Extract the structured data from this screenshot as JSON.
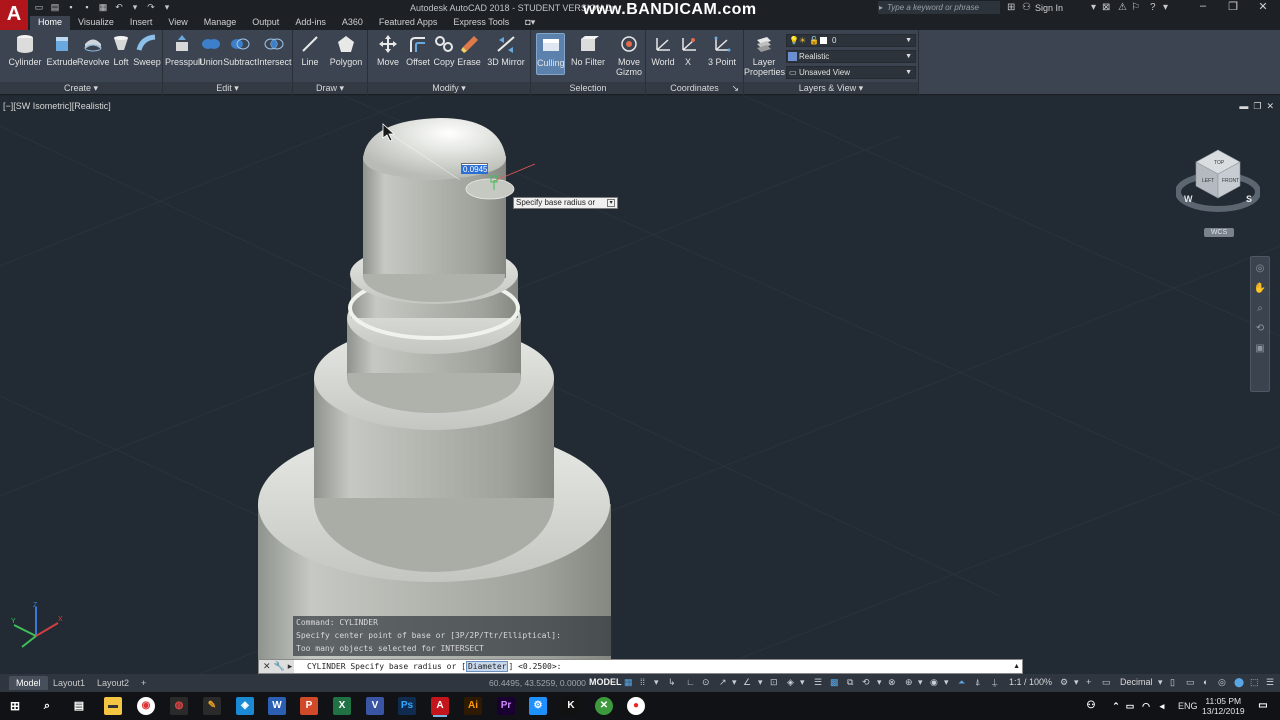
{
  "window": {
    "title": "Autodesk AutoCAD 2018 - STUDENT VERSION    Dr",
    "watermark": "www.BANDICAM.com",
    "search_placeholder": "Type a keyword or phrase",
    "sign_in": "Sign In"
  },
  "app_logo": "A",
  "ribbon_tabs": [
    "Home",
    "Visualize",
    "Insert",
    "View",
    "Manage",
    "Output",
    "Add-ins",
    "A360",
    "Featured Apps",
    "Express Tools"
  ],
  "ribbon": {
    "create": {
      "title": "Create",
      "tools": [
        "Cylinder",
        "Extrude",
        "Revolve",
        "Loft",
        "Sweep"
      ]
    },
    "edit": {
      "title": "Edit",
      "tools": [
        "Presspull",
        "Union",
        "Subtract",
        "Intersect"
      ]
    },
    "draw": {
      "title": "Draw",
      "tools": [
        "Line",
        "Polygon"
      ]
    },
    "modify": {
      "title": "Modify",
      "tools": [
        "Move",
        "Offset",
        "Copy",
        "Erase",
        "3D Mirror"
      ]
    },
    "selection": {
      "title": "Selection",
      "tools": [
        "Culling",
        "No Filter",
        "Move",
        "Gizmo"
      ]
    },
    "coordinates": {
      "title": "Coordinates",
      "tools": [
        "World",
        "X",
        "3 Point"
      ]
    },
    "layers_view": {
      "title": "Layers & View",
      "layer_properties_1": "Layer",
      "layer_properties_2": "Properties",
      "layer_value": "0",
      "visual_style": "Realistic",
      "named_view": "Unsaved View"
    }
  },
  "viewport": {
    "label": "[−][SW Isometric][Realistic]",
    "dynamic_input_value": "0.0945",
    "tooltip": "Specify base radius or",
    "viewcube": {
      "top": "TOP",
      "left": "LEFT",
      "front": "FRONT",
      "compass_w": "W",
      "compass_s": "S"
    },
    "wcs": "WCS"
  },
  "command": {
    "history": [
      "Command:  CYLINDER",
      "Specify center point of base or [3P/2P/Ttr/Elliptical]:",
      "Too many objects selected for INTERSECT"
    ],
    "prompt_prefix": "CYLINDER Specify base radius or [",
    "prompt_option": "Diameter",
    "prompt_suffix": "] <0.2500>:"
  },
  "layout_tabs": [
    "Model",
    "Layout1",
    "Layout2"
  ],
  "status_bar": {
    "coords": "60.4495, 43.5259, 0.0000",
    "model": "MODEL",
    "scale": "1:1 / 100%",
    "units": "Decimal"
  },
  "taskbar": {
    "lang": "ENG",
    "time": "11:05 PM",
    "date": "13/12/2019"
  },
  "colors": {
    "viewport_bg": "#222a33",
    "ribbon_bg": "#3b4450",
    "solid_gray": "#b3b7b1",
    "selection_blue": "#5b81ac"
  }
}
